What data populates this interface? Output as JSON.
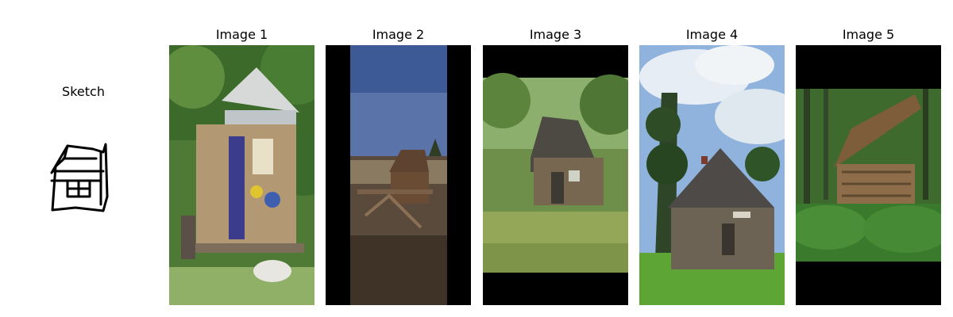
{
  "sketch": {
    "title": "Sketch"
  },
  "images": [
    {
      "title": "Image 1"
    },
    {
      "title": "Image 2"
    },
    {
      "title": "Image 3"
    },
    {
      "title": "Image 4"
    },
    {
      "title": "Image 5"
    }
  ],
  "colors": {
    "background": "#ffffff",
    "letterbox": "#000000",
    "sketch_stroke": "#000000"
  },
  "icons": {
    "sketch": "cabin-sketch-icon"
  }
}
